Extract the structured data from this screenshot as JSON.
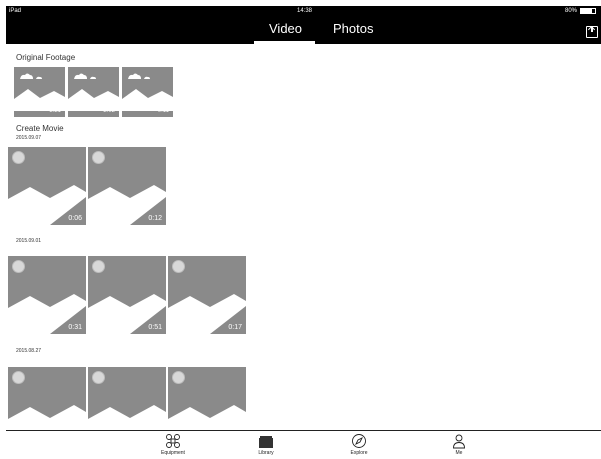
{
  "status": {
    "carrier": "iPad",
    "time": "14:38",
    "battery": "80%",
    "battery_level": 0.8
  },
  "tabs": {
    "video": "Video",
    "photos": "Photos",
    "active": "Video"
  },
  "sections": {
    "original_footage": {
      "title": "Original Footage",
      "durations": [
        "3:21",
        "2:02",
        "0:11"
      ]
    },
    "create_movie": {
      "title": "Create Movie",
      "groups": [
        {
          "date": "2015.09.07",
          "durations": [
            "0:06",
            "0:12"
          ]
        },
        {
          "date": "2015.09.01",
          "durations": [
            "0:31",
            "0:51",
            "0:17"
          ]
        },
        {
          "date": "2015.08.27",
          "durations": [
            "",
            "",
            ""
          ]
        }
      ]
    }
  },
  "tabbar": {
    "equipment": "Equipment",
    "library": "Library",
    "explore": "Explore",
    "me": "Me"
  },
  "icons": {
    "export": "export-icon",
    "equipment": "drone-icon",
    "library": "folder-icon",
    "explore": "compass-icon",
    "me": "person-icon",
    "placeholder": "image-placeholder-icon",
    "select": "select-circle-icon"
  },
  "colors": {
    "header_bg": "#000000",
    "thumb_bg": "#8a8a8a",
    "text": "#333333"
  }
}
